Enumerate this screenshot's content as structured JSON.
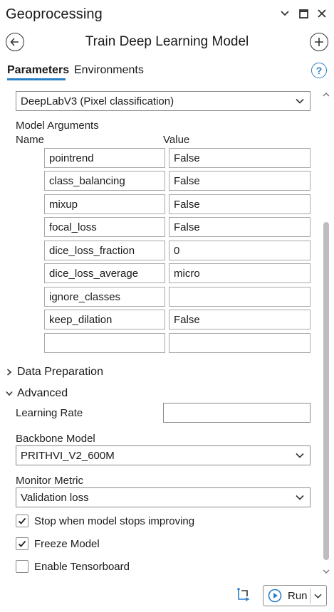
{
  "window": {
    "title": "Geoprocessing"
  },
  "tool": {
    "title": "Train Deep Learning Model"
  },
  "tabs": [
    {
      "label": "Parameters",
      "active": true
    },
    {
      "label": "Environments",
      "active": false
    }
  ],
  "model_type": {
    "value": "DeepLabV3 (Pixel classification)"
  },
  "model_arguments": {
    "label": "Model Arguments",
    "col_name": "Name",
    "col_value": "Value",
    "rows": [
      {
        "name": "pointrend",
        "value": "False"
      },
      {
        "name": "class_balancing",
        "value": "False"
      },
      {
        "name": "mixup",
        "value": "False"
      },
      {
        "name": "focal_loss",
        "value": "False"
      },
      {
        "name": "dice_loss_fraction",
        "value": "0"
      },
      {
        "name": "dice_loss_average",
        "value": "micro"
      },
      {
        "name": "ignore_classes",
        "value": ""
      },
      {
        "name": "keep_dilation",
        "value": "False"
      },
      {
        "name": "",
        "value": ""
      }
    ]
  },
  "sections": {
    "data_preparation": "Data Preparation",
    "advanced": "Advanced"
  },
  "advanced": {
    "learning_rate_label": "Learning Rate",
    "learning_rate_value": "",
    "backbone_label": "Backbone Model",
    "backbone_value": "PRITHVI_V2_600M",
    "monitor_label": "Monitor Metric",
    "monitor_value": "Validation loss",
    "checks": [
      {
        "label": "Stop when model stops improving",
        "checked": true
      },
      {
        "label": "Freeze Model",
        "checked": true
      },
      {
        "label": "Enable Tensorboard",
        "checked": false
      }
    ]
  },
  "footer": {
    "run_label": "Run"
  },
  "colors": {
    "accent": "#2a7fc7"
  }
}
